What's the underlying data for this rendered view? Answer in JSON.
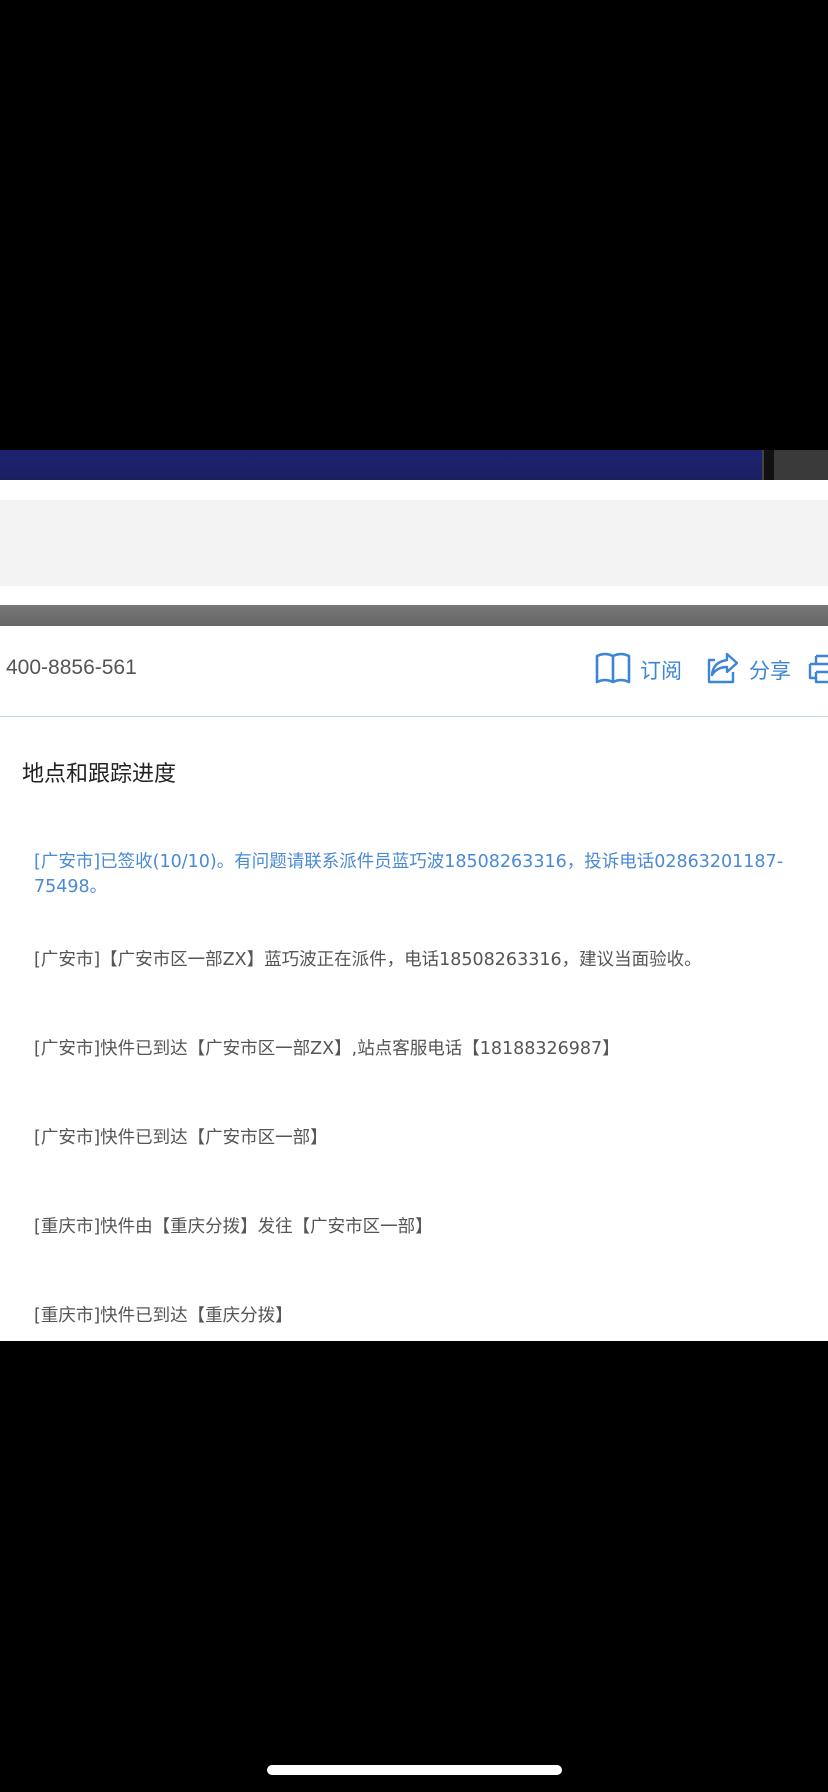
{
  "header": {
    "phone": "400-8856-561",
    "subscribe_label": "订阅",
    "share_label": "分享"
  },
  "tracking": {
    "title": "地点和跟踪进度",
    "events": [
      "[广安市]已签收(10/10)。有问题请联系派件员蓝巧波18508263316，投诉电话02863201187-75498。",
      "[广安市]【广安市区一部ZX】蓝巧波正在派件，电话18508263316，建议当面验收。",
      "[广安市]快件已到达【广安市区一部ZX】,站点客服电话【18188326987】",
      "[广安市]快件已到达【广安市区一部】",
      "[重庆市]快件由【重庆分拨】发往【广安市区一部】",
      "[重庆市]快件已到达【重庆分拨】"
    ]
  },
  "colors": {
    "accent": "#3d86d6",
    "latest_event": "#4a8ad4",
    "text": "#555555"
  },
  "icons": [
    "book-icon",
    "share-icon",
    "print-icon"
  ]
}
